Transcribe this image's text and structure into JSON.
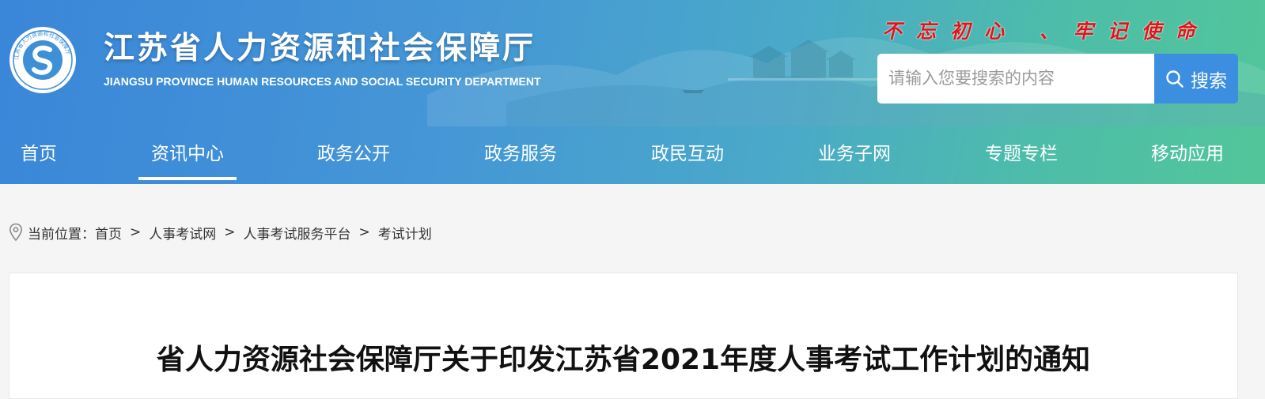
{
  "header": {
    "title": "江苏省人力资源和社会保障厅",
    "subtitle": "JIANGSU PROVINCE HUMAN RESOURCES AND SOCIAL SECURITY DEPARTMENT",
    "slogan": "不忘初心 、牢记使命",
    "logo_ring_text": "江苏省人力资源和社会保障厅"
  },
  "search": {
    "placeholder": "请输入您要搜索的内容",
    "button_label": "搜索"
  },
  "nav": {
    "items": [
      {
        "label": "首页",
        "active": false
      },
      {
        "label": "资讯中心",
        "active": true
      },
      {
        "label": "政务公开",
        "active": false
      },
      {
        "label": "政务服务",
        "active": false
      },
      {
        "label": "政民互动",
        "active": false
      },
      {
        "label": "业务子网",
        "active": false
      },
      {
        "label": "专题专栏",
        "active": false
      },
      {
        "label": "移动应用",
        "active": false
      }
    ]
  },
  "breadcrumb": {
    "prefix": "当前位置：",
    "separator": ">",
    "items": [
      "首页",
      "人事考试网",
      "人事考试服务平台",
      "考试计划"
    ]
  },
  "article": {
    "title": "省人力资源社会保障厅关于印发江苏省2021年度人事考试工作计划的通知"
  },
  "colors": {
    "header_gradient_start": "#3a86d9",
    "header_gradient_end": "#52c69a",
    "slogan": "#e0141a",
    "search_button": "#3b8ee0"
  },
  "icons": [
    "site-logo-emblem",
    "search-icon",
    "location-pin-icon"
  ]
}
